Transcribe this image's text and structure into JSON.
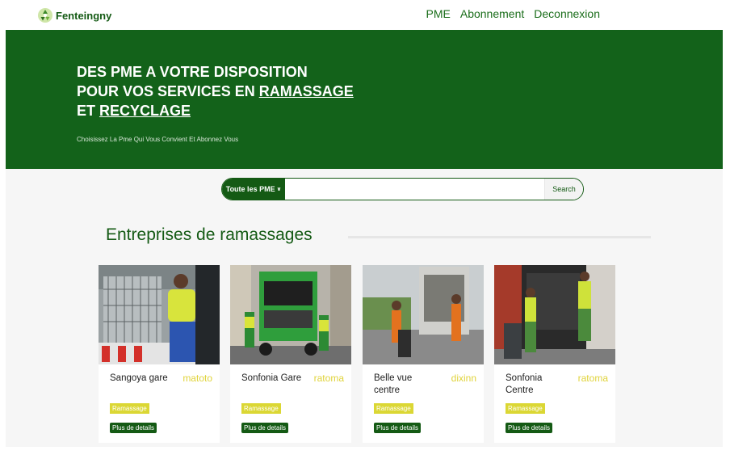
{
  "brand": {
    "name": "Fenteingny",
    "icon": "recycle-icon"
  },
  "nav": {
    "links": [
      "PME",
      "Abonnement",
      "Deconnexion"
    ]
  },
  "hero": {
    "line1": "DES PME A VOTRE DISPOSITION",
    "line2_prefix": "POUR VOS SERVICES EN ",
    "line2_underlined": "RAMASSAGE",
    "line3_prefix": "ET ",
    "line3_underlined": "RECYCLAGE",
    "subtitle": "Choisissez La Pme Qui Vous Convient Et Abonnez Vous"
  },
  "search": {
    "dropdown_label": "Toute les PME",
    "input_value": "",
    "placeholder": "",
    "button_label": "Search"
  },
  "section": {
    "title": "Entreprises de ramassages"
  },
  "cards": [
    {
      "name": "Sangoya gare",
      "location": "matoto",
      "badge": "Ramassage",
      "button": "Plus de details"
    },
    {
      "name": "Sonfonia Gare",
      "location": "ratoma",
      "badge": "Ramassage",
      "button": "Plus de details"
    },
    {
      "name": "Belle vue centre",
      "location": "dixinn",
      "badge": "Ramassage",
      "button": "Plus de details"
    },
    {
      "name": "Sonfonia Centre",
      "location": "ratoma",
      "badge": "Ramassage",
      "button": "Plus de details"
    }
  ],
  "colors": {
    "brand_green": "#145a14",
    "hero_green": "#13621a",
    "accent_yellow": "#dbd734"
  }
}
